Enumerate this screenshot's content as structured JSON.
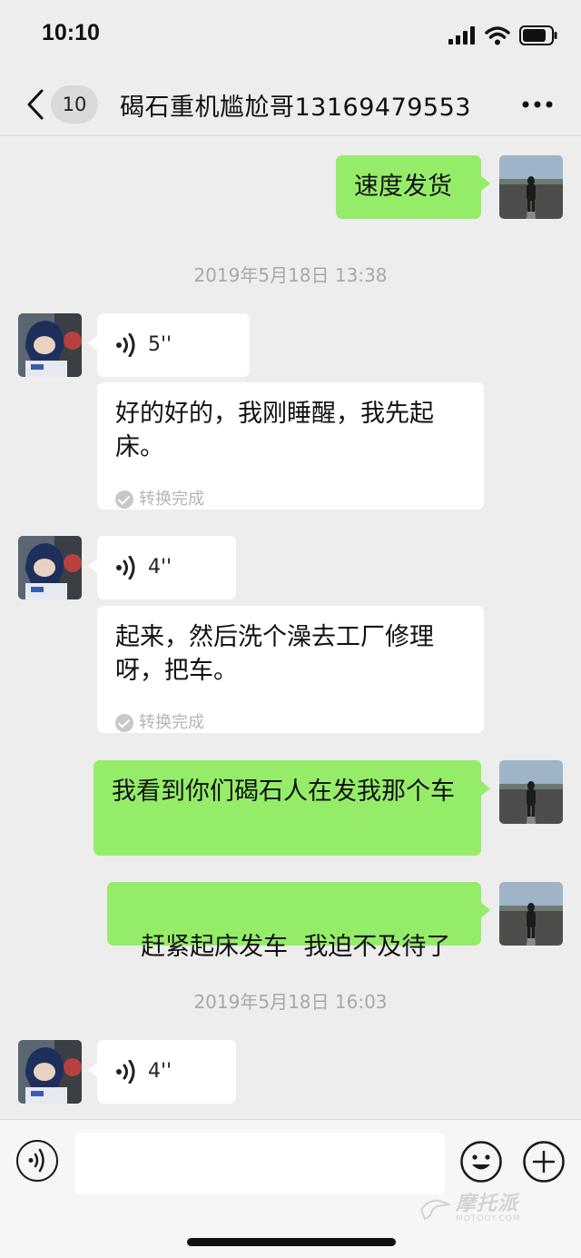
{
  "status_bar": {
    "time": "10:10"
  },
  "nav": {
    "back_count": "10",
    "title": "碣石重机尴尬哥13169479553"
  },
  "messages": [
    {
      "kind": "text",
      "side": "out",
      "text": "速度发货"
    },
    {
      "kind": "timestamp",
      "text": "2019年5月18日 13:38"
    },
    {
      "kind": "voice",
      "side": "in",
      "duration": "5''"
    },
    {
      "kind": "transcript",
      "text": "好的好的，我刚睡醒，我先起床。",
      "status": "转换完成"
    },
    {
      "kind": "voice",
      "side": "in",
      "duration": "4''"
    },
    {
      "kind": "transcript",
      "text": "起来，然后洗个澡去工厂修理呀，把车。",
      "status": "转换完成"
    },
    {
      "kind": "text",
      "side": "out",
      "text": "我看到你们碣石人在发我那个车"
    },
    {
      "kind": "text",
      "side": "out",
      "text": "赶紧起床发车  我迫不及待了"
    },
    {
      "kind": "timestamp",
      "text": "2019年5月18日 16:03"
    },
    {
      "kind": "voice",
      "side": "in",
      "duration": "4''"
    }
  ],
  "input_bar": {
    "placeholder": ""
  },
  "watermark": {
    "main": "摩托派",
    "sub": "MOTOOY.COM"
  },
  "colors": {
    "outgoing_bubble": "#95ec69",
    "incoming_bubble": "#ffffff",
    "background": "#ededed"
  },
  "icons": [
    "back-chevron-icon",
    "more-icon",
    "voice-wave-icon",
    "check-circle-icon",
    "voice-input-icon",
    "emoji-icon",
    "plus-icon",
    "signal-icon",
    "wifi-icon",
    "battery-icon"
  ]
}
